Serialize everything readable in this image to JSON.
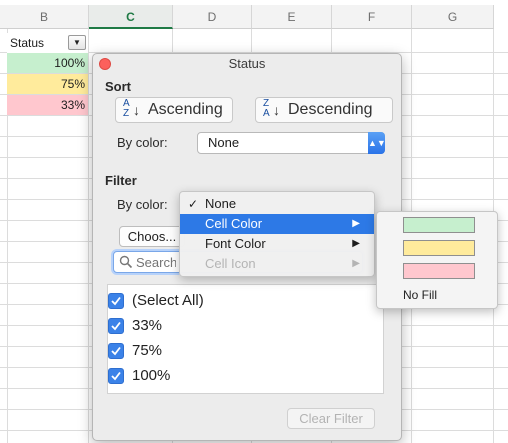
{
  "columns": [
    "B",
    "C",
    "D",
    "E",
    "F",
    "G"
  ],
  "active_column": "C",
  "sheet": {
    "header_label": "Status",
    "filter_icon": "filter-dropdown-icon",
    "rows": [
      {
        "value": "100%",
        "fill": "#c6efce"
      },
      {
        "value": "75%",
        "fill": "#ffeb9c"
      },
      {
        "value": "33%",
        "fill": "#ffc7ce"
      }
    ]
  },
  "popover": {
    "title": "Status",
    "sort": {
      "section_label": "Sort",
      "ascending_label": "Ascending",
      "descending_label": "Descending",
      "by_color_label": "By color:",
      "by_color_value": "None"
    },
    "filter": {
      "section_label": "Filter",
      "by_color_label": "By color:",
      "choose_label": "Choos...",
      "search_placeholder": "Search",
      "items": [
        {
          "label": "(Select All)",
          "checked": true
        },
        {
          "label": "33%",
          "checked": true
        },
        {
          "label": "75%",
          "checked": true
        },
        {
          "label": "100%",
          "checked": true
        }
      ],
      "clear_label": "Clear Filter"
    }
  },
  "menu": {
    "items": [
      {
        "label": "None",
        "checked": true,
        "submenu": false,
        "highlighted": false,
        "disabled": false
      },
      {
        "label": "Cell Color",
        "checked": false,
        "submenu": true,
        "highlighted": true,
        "disabled": false
      },
      {
        "label": "Font Color",
        "checked": false,
        "submenu": true,
        "highlighted": false,
        "disabled": false
      },
      {
        "label": "Cell Icon",
        "checked": false,
        "submenu": true,
        "highlighted": false,
        "disabled": true
      }
    ]
  },
  "color_submenu": {
    "swatches": [
      "#c6efce",
      "#ffeb9c",
      "#ffc7ce"
    ],
    "no_fill_label": "No Fill"
  },
  "colors": {
    "accent": "#2d79e6",
    "close_button": "#fc605c",
    "active_column_header": "#1f7a45"
  }
}
